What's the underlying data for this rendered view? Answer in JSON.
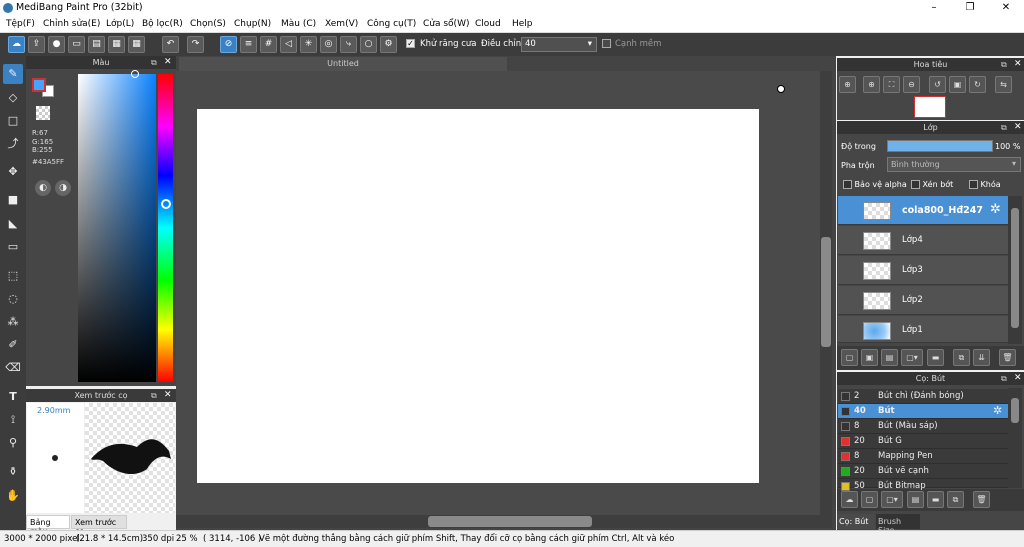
{
  "window": {
    "title": "MediBang Paint Pro (32bit)",
    "minimize": "–",
    "maximize": "❐",
    "close": "✕"
  },
  "menu": [
    "Tệp(F)",
    "Chỉnh sửa(E)",
    "Lớp(L)",
    "Bộ lọc(R)",
    "Chọn(S)",
    "Chụp(N)",
    "Màu (C)",
    "Xem(V)",
    "Công cụ(T)",
    "Cửa sổ(W)",
    "Cloud",
    "Help"
  ],
  "toolbar": {
    "antialias_label": "Khử răng cưa",
    "adjust_label": "Điều chỉnh",
    "adjust_value": "40",
    "sharp_edge_label": "Cạnh mềm"
  },
  "color_panel": {
    "title": "Màu",
    "r": "R:67",
    "g": "G:165",
    "b": "B:255",
    "hex": "#43A5FF",
    "accent": "#43A5FF"
  },
  "brush_preview": {
    "title": "Xem trước cọ",
    "size": "2.90mm",
    "tab_palette": "Bảng màu",
    "tab_preview": "Xem trước cọ"
  },
  "canvas": {
    "tab": "Untitled"
  },
  "navigator": {
    "title": "Hoa tiêu"
  },
  "layer_panel": {
    "title": "Lớp",
    "opacity_label": "Độ trong",
    "opacity_value": "100 %",
    "opacity_percent": 100,
    "blend_label": "Pha trộn",
    "blend_value": "Bình thường",
    "protect_alpha": "Bảo vệ alpha",
    "clip": "Xén bớt",
    "lock": "Khóa",
    "layers": [
      {
        "name": "cola800_Hđ247"
      },
      {
        "name": "Lớp4"
      },
      {
        "name": "Lớp3"
      },
      {
        "name": "Lớp2"
      },
      {
        "name": "Lớp1"
      }
    ]
  },
  "brush_panel": {
    "title": "Cọ: Bút",
    "brushes": [
      {
        "size": "2",
        "name": "Bút chì (Đánh bóng)",
        "color": "#333333"
      },
      {
        "size": "40",
        "name": "Bút",
        "color": "#333333"
      },
      {
        "size": "8",
        "name": "Bút (Màu sáp)",
        "color": "#333333"
      },
      {
        "size": "20",
        "name": "Bút G",
        "color": "#e03030"
      },
      {
        "size": "8",
        "name": "Mapping Pen",
        "color": "#e03030"
      },
      {
        "size": "20",
        "name": "Bút vẽ cạnh",
        "color": "#22aa22"
      },
      {
        "size": "50",
        "name": "Bút Bitmap",
        "color": "#e0c020"
      }
    ],
    "tab_brush": "Cọ: Bút",
    "tab_size": "Brush Size"
  },
  "status": {
    "size": "3000 * 2000 pixel",
    "cm": "(21.8 * 14.5cm)",
    "dpi": "350 dpi",
    "zoom": "25 %",
    "coords": "( 3114, -106 )",
    "hint": "Vẽ một đường thẳng bằng cách giữ phím Shift, Thay đổi cỡ cọ bằng cách giữ phím Ctrl, Alt và kéo"
  }
}
